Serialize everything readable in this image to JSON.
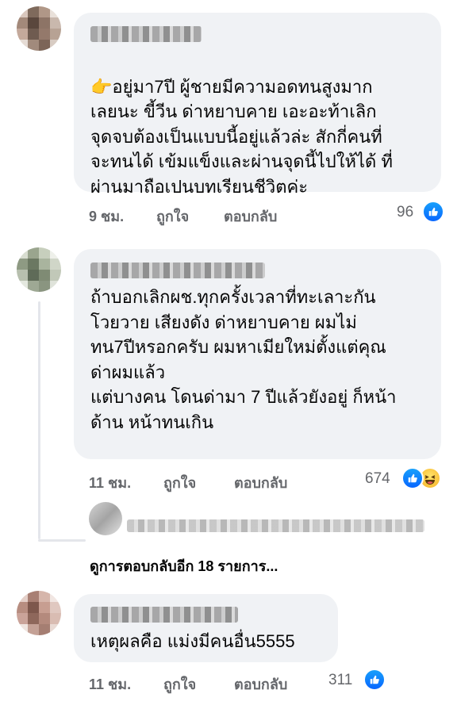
{
  "comments": [
    {
      "text": "อยู่มา7ปี ผู้ชายมีความอดทนสูงมาก\nเลยนะ ขี้วีน ด่าหยาบคาย เอะอะท้าเลิก\nจุดจบต้องเป็นแบบนี้อยู่แล้วล่ะ สักกี่คนที่\nจะทนได้ เข้มแข็งและผ่านจุดนี้ไปให้ได้ ที่\nผ่านมาถือเปนบทเรียนชีวิตค่ะ",
      "time": "9 ชม.",
      "like_label": "ถูกใจ",
      "reply_label": "ตอบกลับ",
      "reactions": "96",
      "emoji": "👉"
    },
    {
      "text": "ถ้าบอกเลิกผช.ทุกครั้งเวลาที่ทะเลาะกัน\nโวยวาย เสียงดัง ด่าหยาบคาย ผมไม่\nทน7ปีหรอกครับ ผมหาเมียใหม่ตั้งแต่คุณ\nด่าผมแล้ว\nแต่บางคน โดนด่ามา 7 ปีแล้วยังอยู่ ก็หน้า\nด้าน หน้าทนเกิน",
      "time": "11 ชม.",
      "like_label": "ถูกใจ",
      "reply_label": "ตอบกลับ",
      "reactions": "674"
    },
    {
      "text": "เหตุผลคือ แม่งมีคนอื่น5555",
      "time": "11 ชม.",
      "like_label": "ถูกใจ",
      "reply_label": "ตอบกลับ",
      "reactions": "311"
    }
  ],
  "view_more_replies": "ดูการตอบกลับอีก 18 รายการ...",
  "colors": {
    "bubble": "#f0f2f5",
    "meta": "#65676b",
    "like_blue": "#0866ff"
  }
}
